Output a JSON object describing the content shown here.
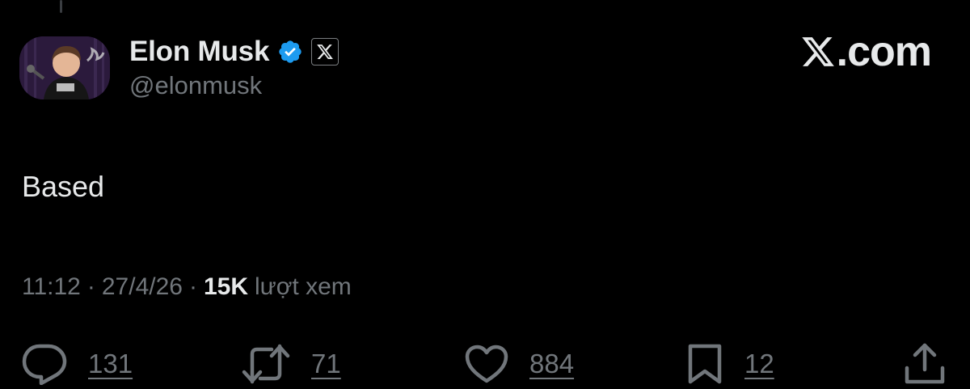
{
  "author": {
    "display_name": "Elon Musk",
    "handle": "@elonmusk",
    "verified_color": "#1d9bf0",
    "badge_icon": "x-logo-icon"
  },
  "brand": {
    "text": ".com",
    "icon": "x-logo-icon"
  },
  "tweet": {
    "text": "Based"
  },
  "meta": {
    "time": "11:12",
    "separator": "·",
    "date": "27/4/26",
    "views_count": "15K",
    "views_label": "lượt xem"
  },
  "actions": {
    "replies": {
      "icon": "reply-bubble-icon",
      "count": "131"
    },
    "reposts": {
      "icon": "repost-icon",
      "count": "71"
    },
    "likes": {
      "icon": "heart-icon",
      "count": "884"
    },
    "bookmarks": {
      "icon": "bookmark-icon",
      "count": "12"
    },
    "share": {
      "icon": "share-icon"
    }
  },
  "colors": {
    "background": "#000000",
    "primary_text": "#e7e9ea",
    "secondary_text": "#71767b",
    "accent": "#1d9bf0"
  }
}
